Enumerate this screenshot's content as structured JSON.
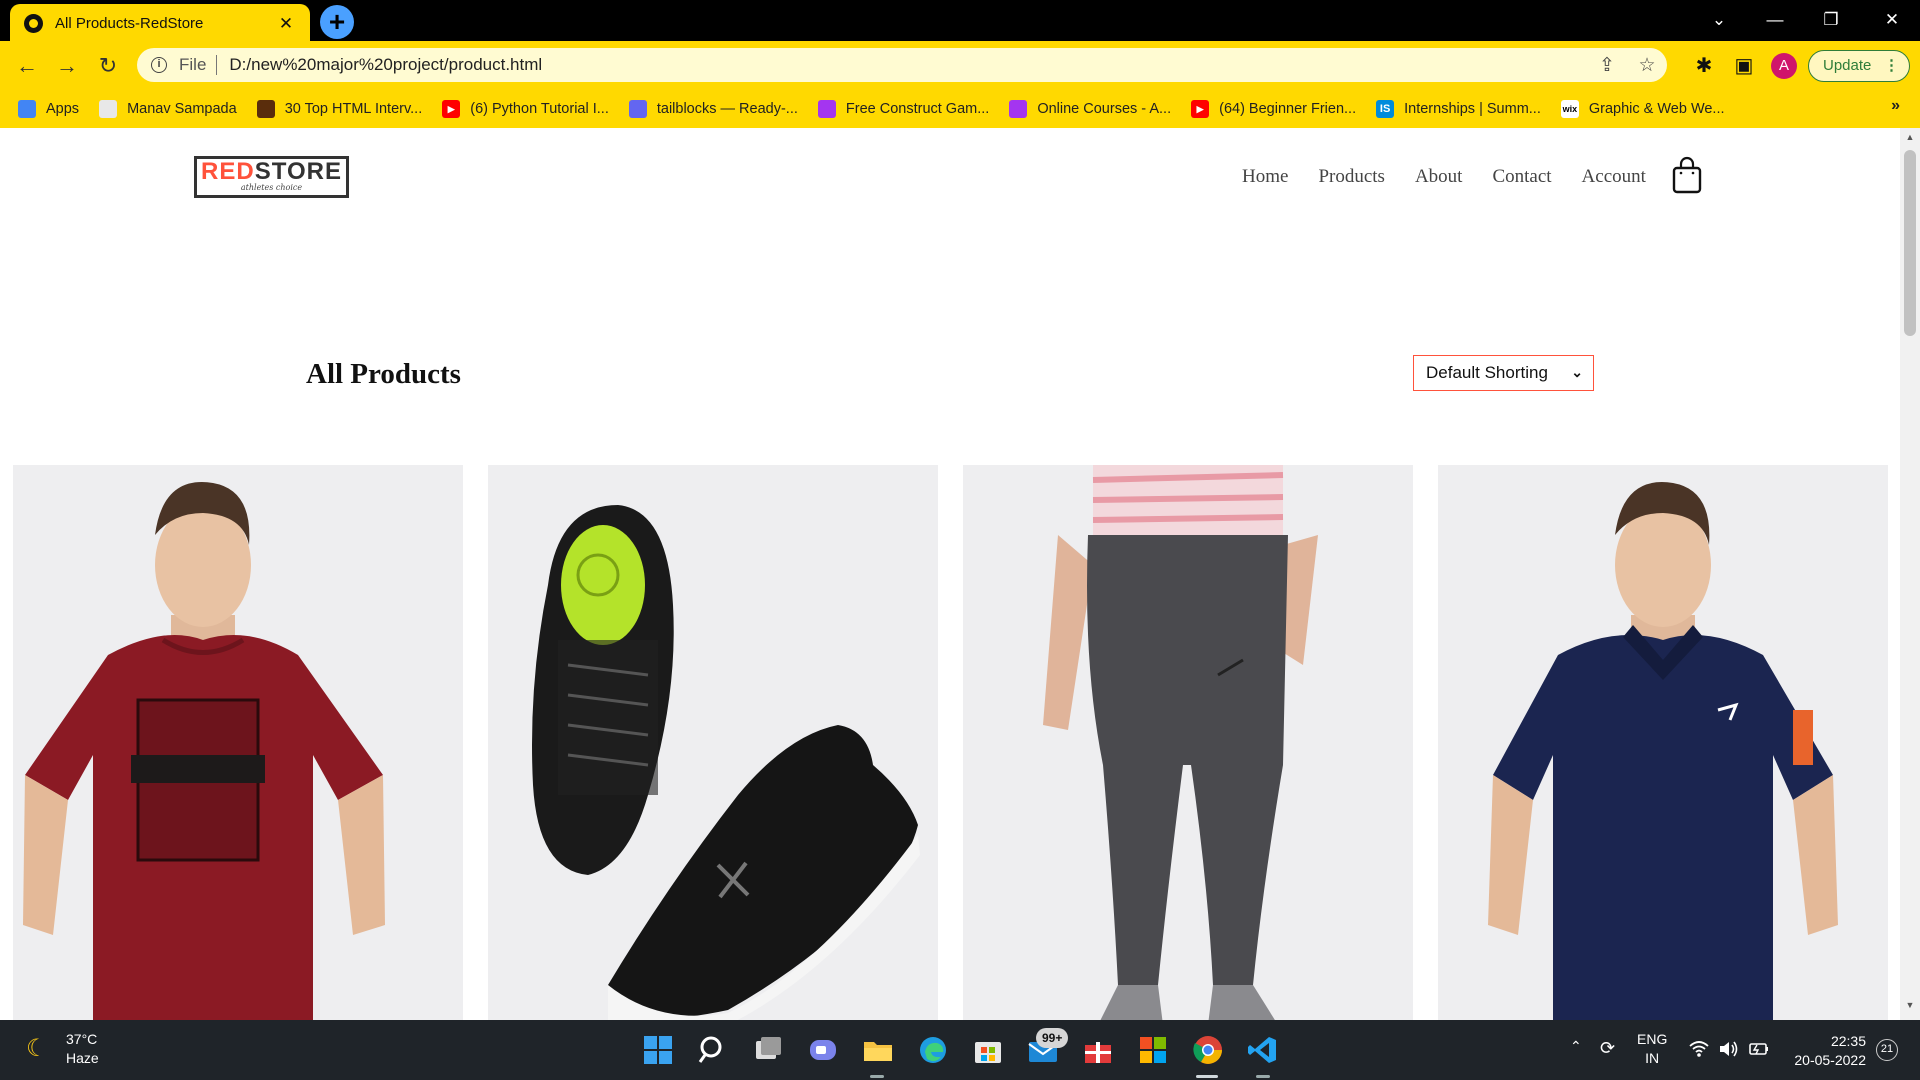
{
  "browser": {
    "tab_title": "All Products-RedStore",
    "tab_close": "✕",
    "new_tab": "+",
    "url_scheme": "File",
    "url": "D:/new%20major%20project/product.html",
    "profile_initial": "A",
    "update_label": "Update",
    "update_menu": "⋮",
    "bookmarks_overflow": "»"
  },
  "bookmarks": [
    {
      "label": "Apps",
      "icon": "apps-grid-icon",
      "color": "#4285f4"
    },
    {
      "label": "Manav Sampada",
      "icon": "document-icon",
      "color": "#e8e8e8"
    },
    {
      "label": "30 Top HTML Interv...",
      "icon": "site-icon",
      "color": "#5a2d0c"
    },
    {
      "label": "(6) Python Tutorial I...",
      "icon": "youtube-icon",
      "color": "#ff0000"
    },
    {
      "label": "tailblocks — Ready-...",
      "icon": "tailblocks-icon",
      "color": "#6366f1"
    },
    {
      "label": "Free Construct Gam...",
      "icon": "udemy-icon",
      "color": "#a435f0"
    },
    {
      "label": "Online Courses - A...",
      "icon": "udemy-icon",
      "color": "#a435f0"
    },
    {
      "label": "(64) Beginner Frien...",
      "icon": "youtube-icon",
      "color": "#ff0000"
    },
    {
      "label": "Internships | Summ...",
      "icon": "internshala-icon",
      "color": "#008bdc"
    },
    {
      "label": "Graphic & Web We...",
      "icon": "wix-icon",
      "color": "#ffffff"
    }
  ],
  "site": {
    "logo_red": "RED",
    "logo_dark": "STORE",
    "logo_tagline": "athletes choice",
    "nav": [
      "Home",
      "Products",
      "About",
      "Contact",
      "Account"
    ],
    "heading": "All Products",
    "sort_selected": "Default Shorting",
    "sort_chevron": "⌄",
    "accent_color": "#ff523b"
  },
  "products": [
    {
      "image": "red-tshirt-model",
      "color": "#8b1a24"
    },
    {
      "image": "black-running-shoes",
      "color": "#1a1a1a"
    },
    {
      "image": "grey-joggers",
      "color": "#4a4a4e"
    },
    {
      "image": "navy-polo-model",
      "color": "#1b2550"
    }
  ],
  "taskbar": {
    "temperature": "37°C",
    "condition": "Haze",
    "mail_badge": "99+",
    "lang_top": "ENG",
    "lang_bottom": "IN",
    "time": "22:35",
    "date": "20-05-2022",
    "notifications": "21"
  }
}
